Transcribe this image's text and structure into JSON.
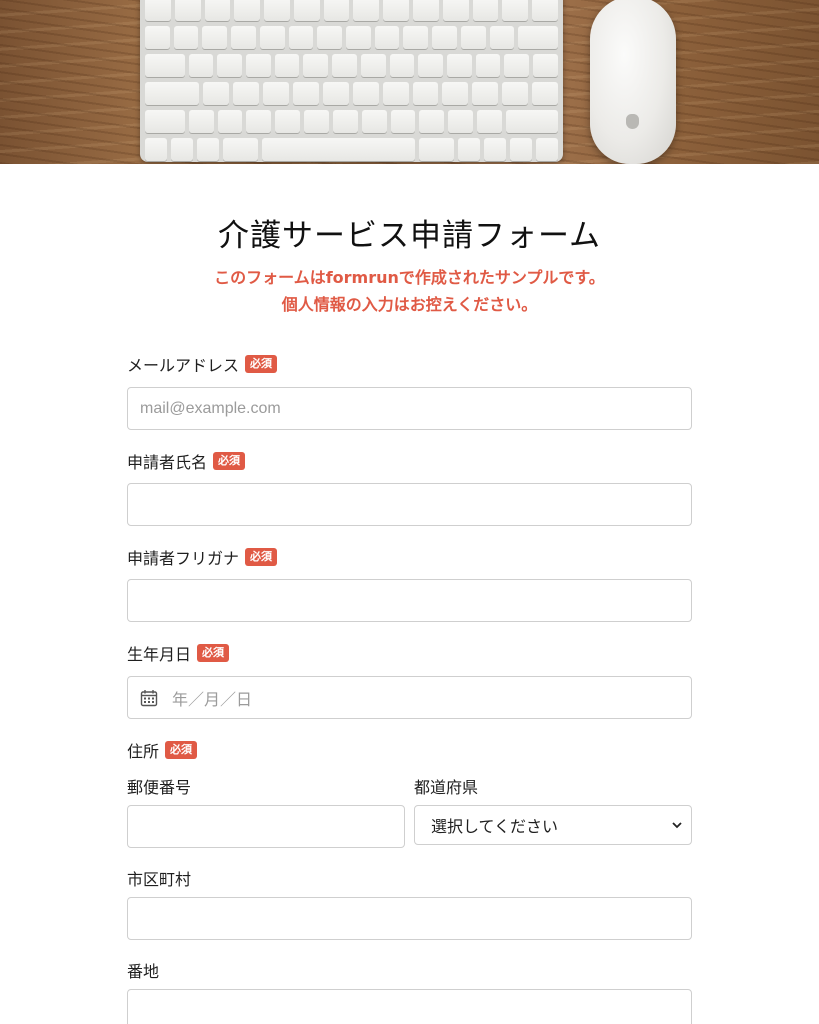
{
  "form": {
    "title": "介護サービス申請フォーム",
    "notice_line1": "このフォームはformrunで作成されたサンプルです。",
    "notice_line2": "個人情報の入力はお控えください。",
    "required_badge": "必須",
    "fields": {
      "email": {
        "label": "メールアドレス",
        "placeholder": "mail@example.com",
        "value": ""
      },
      "name": {
        "label": "申請者氏名",
        "value": ""
      },
      "kana": {
        "label": "申請者フリガナ",
        "value": ""
      },
      "birthdate": {
        "label": "生年月日",
        "placeholder": "年／月／日"
      },
      "address": {
        "label": "住所",
        "postal_label": "郵便番号",
        "postal_value": "",
        "prefecture_label": "都道府県",
        "prefecture_selected": "選択してください",
        "city_label": "市区町村",
        "city_value": "",
        "street_label": "番地",
        "street_value": ""
      }
    }
  },
  "hero": {
    "image": "keyboard-and-mouse-on-wooden-desk"
  },
  "colors": {
    "accent": "#e05a45",
    "border": "#cfcfcf"
  }
}
